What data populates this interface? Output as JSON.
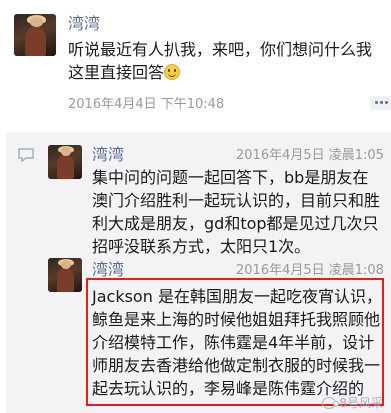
{
  "post": {
    "author": "湾湾",
    "text": "听说最近有人扒我，来吧，你们想问什么我这里直接回答",
    "timestamp": "2016年4月4日 下午10:48"
  },
  "comments": [
    {
      "author": "湾湾",
      "timestamp": "2016年4月5日 凌晨1:05",
      "text": "集中问的问题一起回答下，bb是朋友在澳门介绍胜利一起玩认识的，目前只和胜利大成是朋友，gd和top都是见过几次只招呼没联系方式，太阳只1次。"
    },
    {
      "author": "湾湾",
      "timestamp": "2016年4月5日 凌晨1:08",
      "text": "Jackson 是在韩国朋友一起吃夜宵认识，鲸鱼是来上海的时候他姐姐拜托我照顾他介绍模特工作，陈伟霆是4年半前，设计师朋友去香港给他做定制衣服的时候我一起去玩认识的，李易峰是陈伟霆介绍的"
    }
  ],
  "icons": {
    "emoji": "smile-emoji-icon",
    "comment": "comment-icon",
    "more": "more-dots-icon",
    "watermark_logo": "wechat-logo-icon"
  },
  "colors": {
    "name_link": "#5b6b91",
    "highlight_border": "#e2201c",
    "comment_bg": "#f3f3f5"
  },
  "watermark": {
    "text": "8号风采"
  }
}
